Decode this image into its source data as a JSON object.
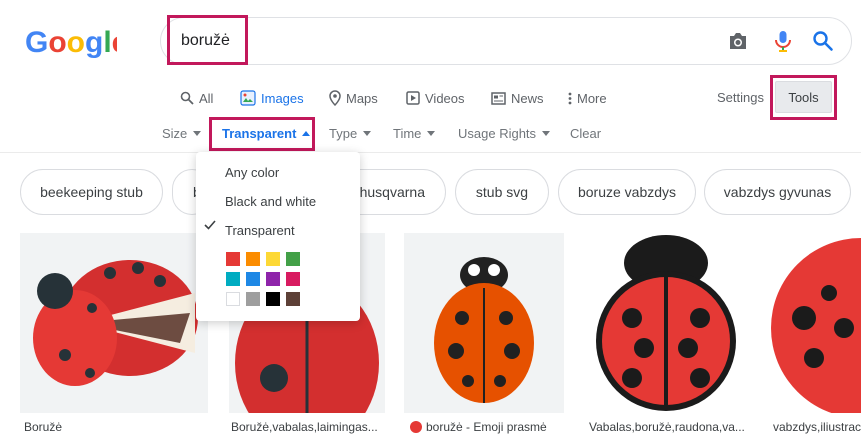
{
  "search": {
    "query": "boružė"
  },
  "nav": {
    "tabs": [
      {
        "label": "All",
        "icon": "search-icon"
      },
      {
        "label": "Images",
        "icon": "image-icon",
        "active": true
      },
      {
        "label": "Maps",
        "icon": "map-pin-icon"
      },
      {
        "label": "Videos",
        "icon": "video-icon"
      },
      {
        "label": "News",
        "icon": "news-icon"
      },
      {
        "label": "More",
        "icon": "more-vert-icon"
      }
    ],
    "settings": "Settings",
    "tools": "Tools"
  },
  "filters": [
    {
      "label": "Size"
    },
    {
      "label": "Transparent",
      "active": true
    },
    {
      "label": "Type"
    },
    {
      "label": "Time"
    },
    {
      "label": "Usage Rights"
    },
    {
      "label": "Clear"
    }
  ],
  "dropdown": {
    "items": [
      "Any color",
      "Black and white",
      "Transparent"
    ],
    "selected": "Transparent",
    "colors": [
      "#e53935",
      "#fb8c00",
      "#fdd835",
      "#43a047",
      "#00acc1",
      "#1e88e5",
      "#8e24aa",
      "#d81b60",
      "#ffffff",
      "#9e9e9e",
      "#000000",
      "#5d4037"
    ]
  },
  "chips": [
    "beekeeping stub",
    "b",
    "husqvarna",
    "stub svg",
    "boruze vabzdys",
    "vabzdys gyvunas"
  ],
  "results": [
    {
      "caption": "Boružė"
    },
    {
      "caption": "Boružė,vabalas,laimingas..."
    },
    {
      "caption": "boružė - Emoji prasmė"
    },
    {
      "caption": "Vabalas,boružė,raudona,va..."
    },
    {
      "caption": "vabzdys,iliustrac"
    }
  ],
  "colors": {
    "accent": "#1a73e8",
    "highlight": "#c2185b"
  }
}
